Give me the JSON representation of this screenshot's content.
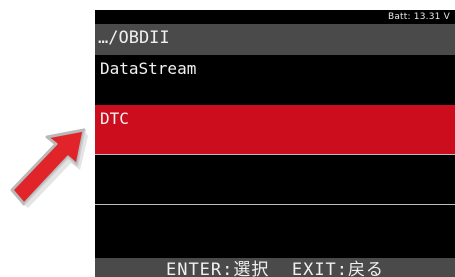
{
  "status": {
    "battery": "Batt: 13.31 V"
  },
  "path": {
    "title": "…/OBDII"
  },
  "menu": {
    "items": [
      {
        "label": "DataStream",
        "selected": false
      },
      {
        "label": "DTC",
        "selected": true
      },
      {
        "label": "",
        "selected": false
      },
      {
        "label": "",
        "selected": false
      }
    ]
  },
  "footer": {
    "hint": "ENTER:選択  EXIT:戻る"
  },
  "colors": {
    "screen_bg": "#000000",
    "bar_bg": "#4a4a4a",
    "selected_bg": "#cc0d1e",
    "text": "#f0f0f0",
    "arrow": "#e0242a"
  },
  "icons": {
    "pointer": "red-pointer-arrow-icon"
  }
}
